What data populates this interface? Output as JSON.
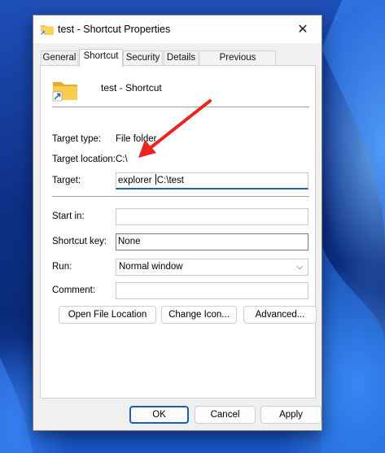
{
  "window": {
    "title": "test - Shortcut Properties",
    "close_icon": "close-icon"
  },
  "tabs": [
    {
      "label": "General",
      "active": false
    },
    {
      "label": "Shortcut",
      "active": true
    },
    {
      "label": "Security",
      "active": false
    },
    {
      "label": "Details",
      "active": false
    },
    {
      "label": "Previous Versions",
      "active": false
    }
  ],
  "shortcut": {
    "name": "test - Shortcut",
    "target_type_label": "Target type:",
    "target_type_value": "File folder",
    "target_location_label": "Target location:",
    "target_location_value": "C:\\",
    "target_label": "Target:",
    "target_value_before_caret": "explorer ",
    "target_value_after_caret": "C:\\test",
    "start_in_label": "Start in:",
    "start_in_value": "",
    "shortcut_key_label": "Shortcut key:",
    "shortcut_key_value": "None",
    "run_label": "Run:",
    "run_value": "Normal window",
    "comment_label": "Comment:",
    "comment_value": ""
  },
  "actions": {
    "open_file_location": "Open File Location",
    "change_icon": "Change Icon...",
    "advanced": "Advanced..."
  },
  "footer": {
    "ok": "OK",
    "cancel": "Cancel",
    "apply": "Apply"
  },
  "colors": {
    "accent": "#1a5fb4",
    "annotation_arrow": "#e8261d",
    "folder": "#f5c542"
  }
}
